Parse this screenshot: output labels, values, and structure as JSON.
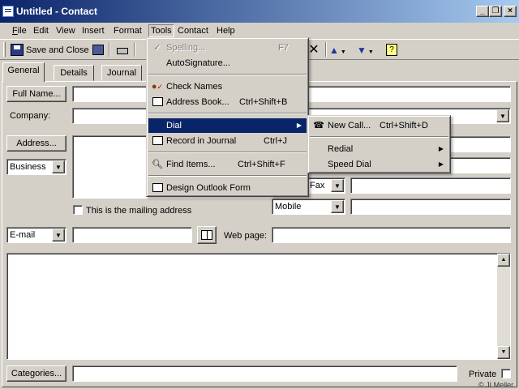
{
  "window": {
    "title": "Untitled - Contact",
    "min_glyph": "_",
    "max_glyph": "❐",
    "close_glyph": "×"
  },
  "menubar": [
    "File",
    "Edit",
    "View",
    "Insert",
    "Format",
    "Tools",
    "Contact",
    "Help"
  ],
  "toolbar": {
    "save_close": "Save and Close"
  },
  "tabs": [
    "General",
    "Details",
    "Journal"
  ],
  "form": {
    "full_name_button": "Full Name...",
    "company_label": "Company:",
    "address_button": "Address...",
    "address_type": "Business",
    "mailing_checkbox_label": "This is the mailing address",
    "phone_fax": "Fax",
    "phone_mobile": "Mobile",
    "email_type": "E-mail",
    "web_page_label": "Web page:",
    "categories_button": "Categories...",
    "private_label": "Private",
    "copyright": "© JLMeller"
  },
  "tools_menu": {
    "items": [
      {
        "label": "Spelling...",
        "shortcut": "F7",
        "disabled": true,
        "icon": "spelling-icon"
      },
      {
        "label": "AutoSignature...",
        "shortcut": "",
        "disabled": false,
        "icon": ""
      },
      {
        "label": "Check Names",
        "shortcut": "",
        "disabled": false,
        "icon": "check-names-icon"
      },
      {
        "label": "Address Book...",
        "shortcut": "Ctrl+Shift+B",
        "disabled": false,
        "icon": "address-book-icon"
      },
      {
        "label": "Dial",
        "shortcut": "",
        "disabled": false,
        "highlighted": true,
        "submenu": true
      },
      {
        "label": "Record in Journal",
        "shortcut": "Ctrl+J",
        "disabled": false,
        "icon": "journal-icon"
      },
      {
        "label": "Find Items...",
        "shortcut": "Ctrl+Shift+F",
        "disabled": false,
        "icon": "find-icon"
      },
      {
        "label": "Design Outlook Form",
        "shortcut": "",
        "disabled": false,
        "icon": "design-form-icon"
      }
    ]
  },
  "dial_submenu": {
    "items": [
      {
        "label": "New Call...",
        "shortcut": "Ctrl+Shift+D",
        "icon": "phone-icon"
      },
      {
        "label": "Redial",
        "submenu": true
      },
      {
        "label": "Speed Dial",
        "submenu": true
      }
    ]
  },
  "colors": {
    "titlebar_start": "#0a246a",
    "titlebar_end": "#a6caf0",
    "face": "#d4d0c8",
    "highlight": "#0a246a"
  }
}
